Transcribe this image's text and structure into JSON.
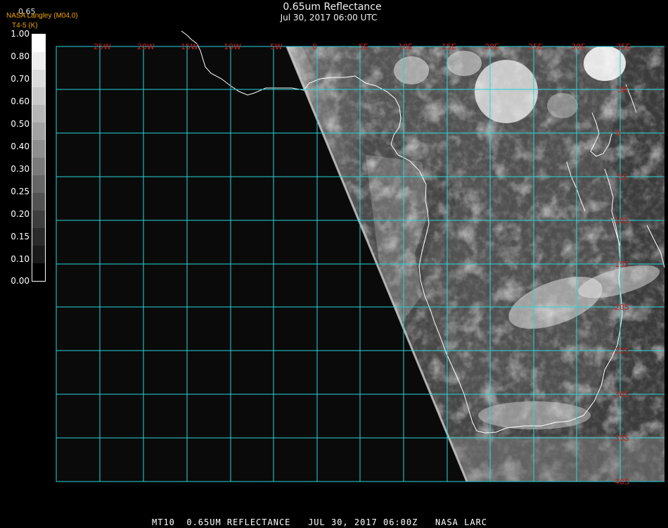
{
  "header": {
    "title": "0.65um Reflectance",
    "subtitle": "Jul 30, 2017 06:00 UTC",
    "credit_line1": "NASA Langley (M04.0)",
    "credit_line2": "T4-5 (K)",
    "scale_top_fragment": "0.65"
  },
  "colorbar": {
    "labels": [
      "1.00",
      "0.80",
      "0.70",
      "0.60",
      "0.50",
      "0.40",
      "0.30",
      "0.25",
      "0.20",
      "0.15",
      "0.10",
      "0.00"
    ],
    "segments": [
      "#ffffff",
      "#eeeeee",
      "#dcdcdc",
      "#cacaca",
      "#b6b6b6",
      "#a2a2a2",
      "#8e8e8e",
      "#7a7a7a",
      "#666666",
      "#525252",
      "#3e3e3e",
      "#2a2a2a",
      "#1a1a1a",
      "#000000"
    ]
  },
  "grid": {
    "color": "#28d7dc",
    "label_color": "#cc1f1f",
    "lon_labels": [
      "25W",
      "20W",
      "15W",
      "10W",
      "5W",
      "0",
      "5E",
      "10E",
      "15E",
      "20E",
      "25E",
      "30E",
      "35E"
    ],
    "lat_labels": [
      "5N",
      "0",
      "5S",
      "10S",
      "15S",
      "20S",
      "25S",
      "30S",
      "35S",
      "40S"
    ]
  },
  "footer": {
    "text": "MT10  0.65UM REFLECTANCE   JUL 30, 2017 06:00Z   NASA LARC"
  }
}
